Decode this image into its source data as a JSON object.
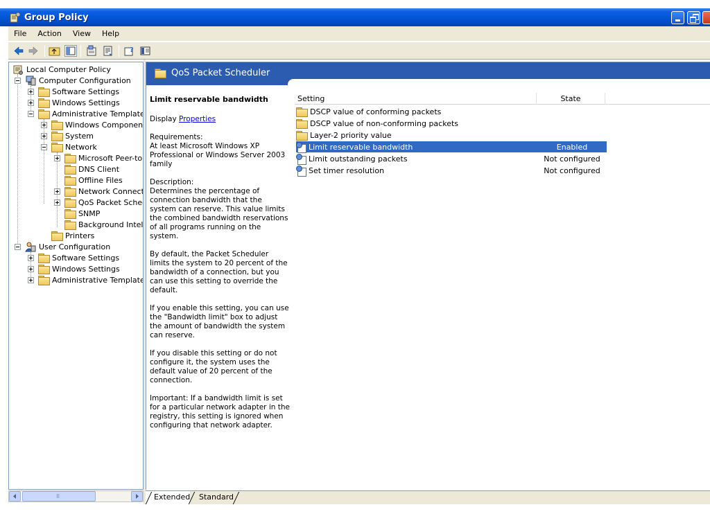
{
  "window": {
    "title": "Group Policy",
    "icons": {
      "app": "group-policy-icon",
      "minimize": "minimize-icon",
      "maximize": "restore-icon",
      "close": "close-icon"
    }
  },
  "menu": [
    "File",
    "Action",
    "View",
    "Help"
  ],
  "toolbar": {
    "buttons": [
      "back-arrow-icon",
      "forward-arrow-icon",
      "up-folder-icon",
      "show-hide-tree-icon",
      "properties-icon",
      "export-list-icon",
      "help-icon",
      "show-hide-description-icon"
    ]
  },
  "tree": {
    "root": "Local Computer Policy",
    "computer_config": "Computer Configuration",
    "cc_software": "Software Settings",
    "cc_windows": "Windows Settings",
    "cc_admin": "Administrative Templates",
    "windows_components": "Windows Components",
    "system": "System",
    "network": "Network",
    "microsoft_peer": "Microsoft Peer-to-Peer Networking Services",
    "dns_client": "DNS Client",
    "offline_files": "Offline Files",
    "network_connections": "Network Connections",
    "qos": "QoS Packet Scheduler",
    "snmp": "SNMP",
    "bits": "Background Intelligent Transfer Service",
    "printers": "Printers",
    "user_config": "User Configuration",
    "uc_software": "Software Settings",
    "uc_windows": "Windows Settings",
    "uc_admin": "Administrative Templates"
  },
  "scrollbar": {
    "thumb_grip": "III"
  },
  "details": {
    "header_title": "QoS Packet Scheduler",
    "description": {
      "heading": "Limit reservable bandwidth",
      "display_prefix": "Display ",
      "properties_link": "Properties ",
      "requirements_label": "Requirements:",
      "requirements_text": "At least Microsoft Windows XP Professional or Windows Server 2003 family",
      "description_label": "Description:",
      "p1": "Determines the percentage of connection bandwidth that the system can reserve. This value limits the combined bandwidth reservations of all programs running on the system.",
      "p2": "By default, the Packet Scheduler limits the system to 20 percent of the bandwidth of a connection, but you can use this setting to override the default.",
      "p3": "If you enable this setting, you can use the \"Bandwidth limit\" box to adjust the amount of bandwidth the system can reserve.",
      "p4": "If you disable this setting or do not configure it, the system uses the default value of 20 percent of the connection.",
      "p5": "Important: If a bandwidth limit is set for a particular network adapter in the registry, this setting is ignored when configuring that network adapter."
    },
    "columns": {
      "setting": "Setting",
      "state": "State"
    },
    "rows": [
      {
        "name": "DSCP value of conforming packets",
        "state": "",
        "icon": "folder-icon"
      },
      {
        "name": "DSCP value of non-conforming packets",
        "state": "",
        "icon": "folder-icon"
      },
      {
        "name": "Layer-2 priority value",
        "state": "",
        "icon": "folder-icon"
      },
      {
        "name": "Limit reservable bandwidth",
        "state": "Enabled",
        "icon": "policy-setting-icon",
        "selected": true
      },
      {
        "name": "Limit outstanding packets",
        "state": "Not configured",
        "icon": "policy-setting-icon"
      },
      {
        "name": "Set timer resolution",
        "state": "Not configured",
        "icon": "policy-setting-icon"
      }
    ]
  },
  "tabs": [
    "Extended",
    "Standard"
  ]
}
